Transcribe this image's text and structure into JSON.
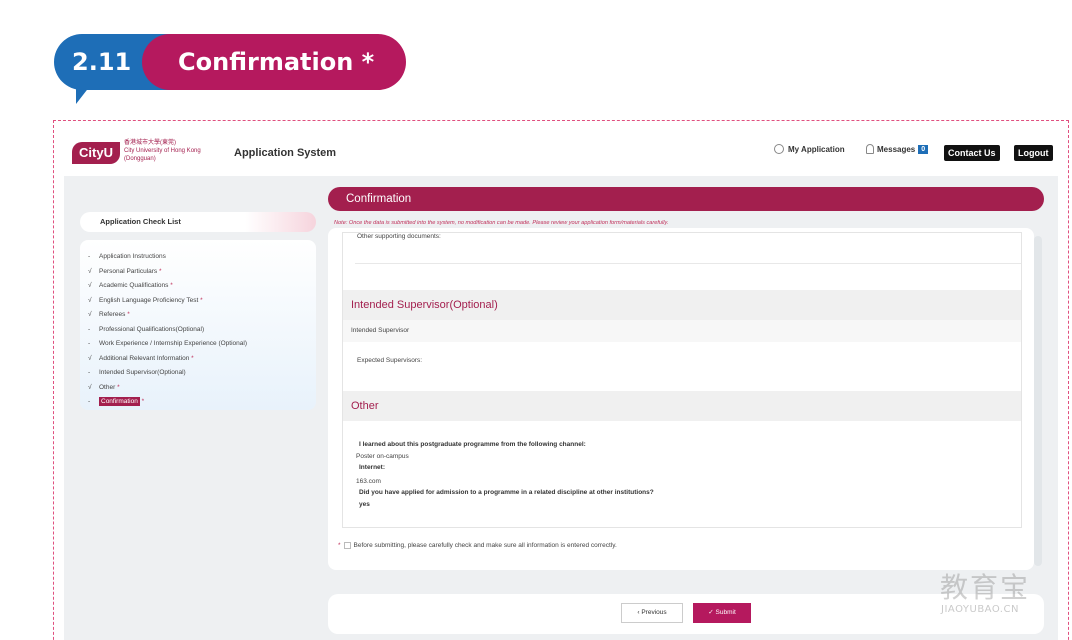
{
  "section": {
    "number": "2.11",
    "title": "Confirmation *"
  },
  "header": {
    "logo_text": "CityU",
    "logo_line1": "香港城市大學(東莞)",
    "logo_line2": "City University of Hong Kong",
    "logo_line3": "(Dongguan)",
    "app_title": "Application System",
    "my_application": "My Application",
    "messages": "Messages",
    "messages_count": "0",
    "contact_us": "Contact Us",
    "logout": "Logout"
  },
  "sidebar": {
    "title": "Application Check List",
    "items": [
      {
        "mark": "-",
        "label": "Application Instructions",
        "req": ""
      },
      {
        "mark": "√",
        "label": "Personal Particulars",
        "req": "*"
      },
      {
        "mark": "√",
        "label": "Academic Qualifications",
        "req": "*"
      },
      {
        "mark": "√",
        "label": "English Language Proficiency Test",
        "req": "*"
      },
      {
        "mark": "√",
        "label": "Referees",
        "req": "*"
      },
      {
        "mark": "-",
        "label": "Professional Qualifications(Optional)",
        "req": ""
      },
      {
        "mark": "-",
        "label": "Work Experience / Internship Experience (Optional)",
        "req": ""
      },
      {
        "mark": "√",
        "label": "Additional Relevant Information",
        "req": "*"
      },
      {
        "mark": "-",
        "label": "Intended Supervisor(Optional)",
        "req": ""
      },
      {
        "mark": "√",
        "label": "Other",
        "req": "*"
      },
      {
        "mark": "-",
        "label": "Confirmation",
        "req": "*"
      }
    ]
  },
  "main": {
    "panel_title": "Confirmation",
    "note": "Note: Once the data is submitted into the system, no modification can be made. Please review your application form/materials carefully.",
    "other_supporting_docs": "Other supporting documents:",
    "intended_supervisor_section": "Intended Supervisor(Optional)",
    "intended_supervisor_sub": "Intended Supervisor",
    "expected_supervisors": "Expected Supervisors:",
    "other_section": "Other",
    "channel_question": "I learned about this postgraduate programme from the following channel:",
    "channel_answer": "Poster on-campus",
    "internet_label": "Internet:",
    "internet_answer": "163.com",
    "applied_question": "Did you have applied for admission to a programme in a related discipline at other institutions?",
    "applied_answer": "yes",
    "confirm_star": "*",
    "confirm_text": "Before submitting, please carefully check and make sure all information is entered correctly.",
    "prev_button": "Previous",
    "submit_button": "Submit"
  },
  "watermark": {
    "cn": "教育宝",
    "en": "JIAOYUBAO.CN"
  },
  "colors": {
    "brand": "#a31f4e",
    "blue": "#1e6eb7",
    "accent": "#b5195e"
  }
}
